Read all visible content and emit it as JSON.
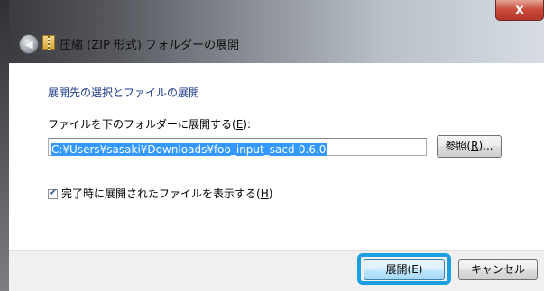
{
  "window": {
    "title": "圧縮 (ZIP 形式) フォルダーの展開",
    "close_label": "x"
  },
  "dialog": {
    "heading": "展開先の選択とファイルの展開",
    "dest_label_text": "ファイルを下のフォルダーに展開する(",
    "dest_label_key": "E",
    "dest_label_end": "):",
    "path_value": "C:¥Users¥sasaki¥Downloads¥foo_input_sacd-0.6.0",
    "browse": {
      "text": "参照(",
      "key": "R",
      "end": ")..."
    },
    "show_files": {
      "checked": true,
      "text": "完了時に展開されたファイルを表示する(",
      "key": "H",
      "end": ")"
    }
  },
  "footer": {
    "extract_label": "展開(E)",
    "cancel_label": "キャンセル",
    "highlight_color": "#1b9fe0"
  },
  "icons": {
    "back": "back-arrow-icon",
    "zip": "zip-folder-icon",
    "close": "close-icon",
    "check": "checkmark-icon"
  }
}
